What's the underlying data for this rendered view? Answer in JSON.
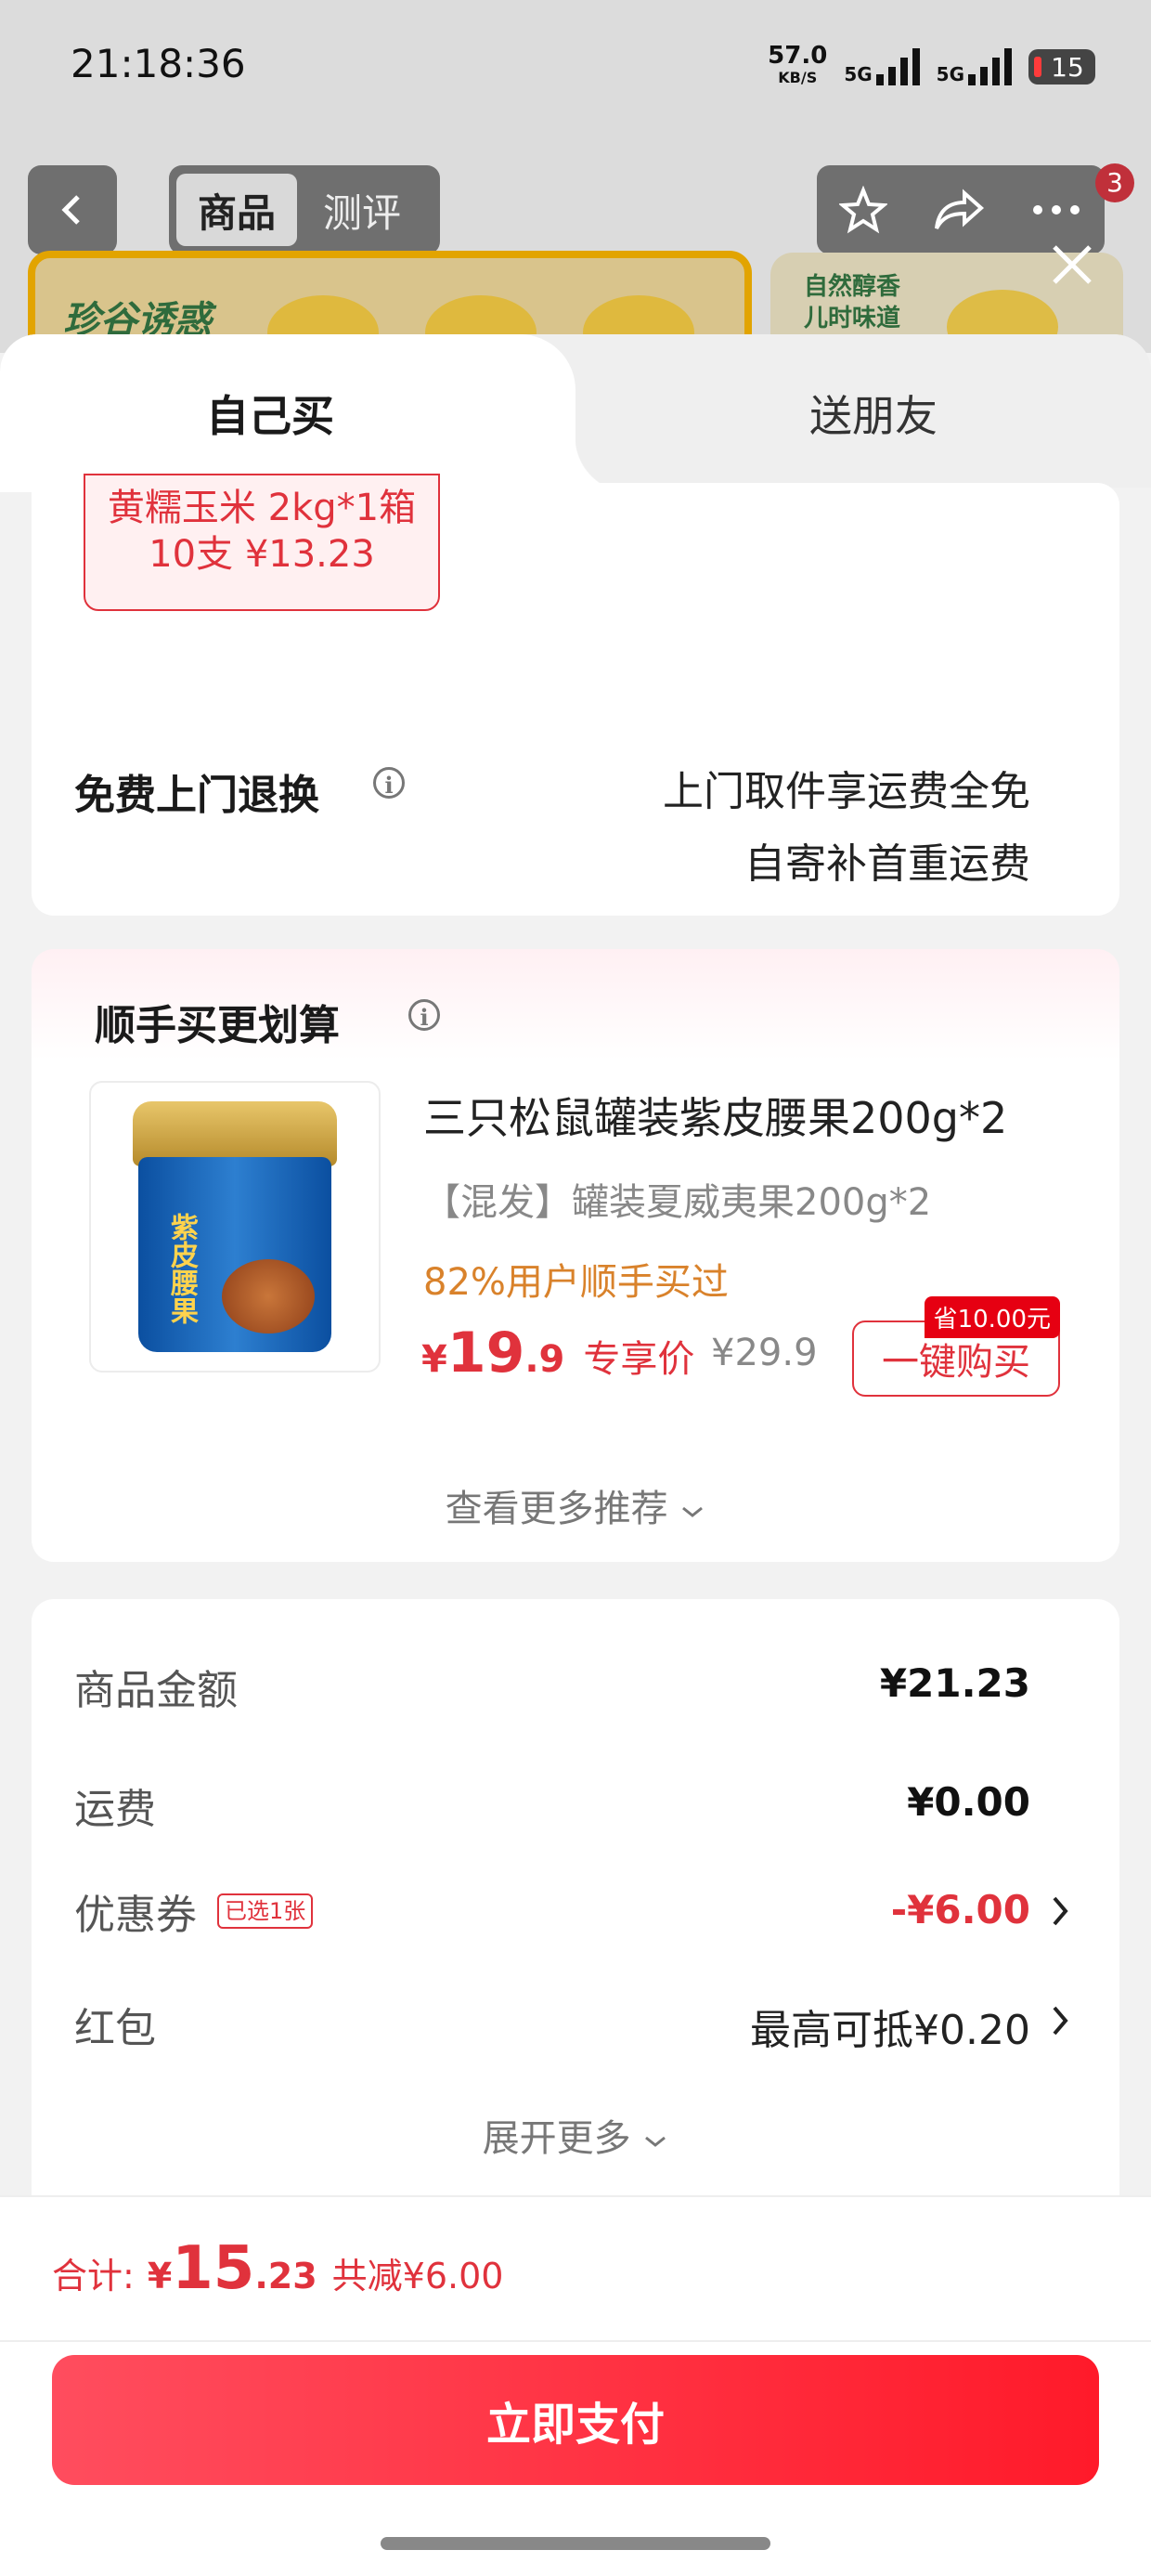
{
  "status_bar": {
    "time": "21:18:36",
    "net_speed": "57.0",
    "net_unit": "KB/S",
    "signal1": "5G",
    "signal2": "5G",
    "battery": "15"
  },
  "background_page": {
    "back_icon": "chevron-left-icon",
    "tabs": [
      "商品",
      "测评"
    ],
    "badge_count": "3",
    "banner_left_brand": "珍谷诱惑",
    "banner_right_text": "自然醇香 儿时味道"
  },
  "sheet": {
    "close_icon": "close-icon",
    "tabs": {
      "self": "自己买",
      "gift": "送朋友"
    },
    "sku_chip": {
      "line1": "黄糯玉米 2kg*1箱",
      "line2": "10支 ¥13.23"
    },
    "return_service": {
      "label": "免费上门退换",
      "line1": "上门取件享运费全免",
      "line2": "自寄补首重运费"
    },
    "recommend": {
      "title": "顺手买更划算",
      "product_name": "三只松鼠罐装紫皮腰果200g*2",
      "product_sub": "【混发】罐装夏威夷果200g*2",
      "jar_text": "紫皮腰果",
      "stat": "82%用户顺手买过",
      "price_symbol": "¥",
      "price_int": "19",
      "price_dec": ".9",
      "price_tag": "专享价",
      "orig_price": "¥29.9",
      "save_tag": "省10.00元",
      "buy_label": "一键购买",
      "more_label": "查看更多推荐"
    },
    "summary": {
      "goods_label": "商品金额",
      "goods_value": "¥21.23",
      "shipping_label": "运费",
      "shipping_value": "¥0.00",
      "coupon_label": "优惠券",
      "coupon_badge": "已选1张",
      "coupon_value": "-¥6.00",
      "redpacket_label": "红包",
      "redpacket_value": "最高可抵¥0.20",
      "expand_label": "展开更多"
    },
    "footer": {
      "total_label": "合计:",
      "total_symbol": "¥",
      "total_int": "15",
      "total_dec": ".23",
      "reduce_text": "共减¥6.00",
      "pay_label": "立即支付"
    }
  },
  "colors": {
    "accent_red": "#e0323c",
    "orange_text": "#d9822b",
    "pay_gradient_start": "#ff4d5e",
    "pay_gradient_end": "#ff1a2a"
  }
}
